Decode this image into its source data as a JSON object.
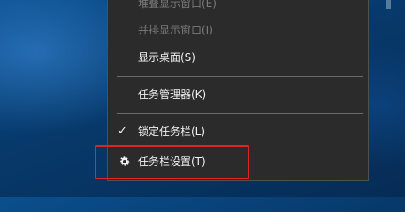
{
  "menu": {
    "items": [
      {
        "label": "堆叠显示窗口(E)",
        "disabled": true
      },
      {
        "label": "并排显示窗口(I)",
        "disabled": true
      },
      {
        "label": "显示桌面(S)",
        "disabled": false
      },
      {
        "label": "任务管理器(K)",
        "disabled": false
      },
      {
        "label": "锁定任务栏(L)",
        "checked": true
      },
      {
        "label": "任务栏设置(T)",
        "icon": "gear-icon",
        "highlighted": true
      }
    ]
  },
  "icons": {
    "check": "✓"
  },
  "colors": {
    "menu_bg": "#2b2b2b",
    "highlight_border": "#e02424",
    "desktop": "#07396a"
  }
}
